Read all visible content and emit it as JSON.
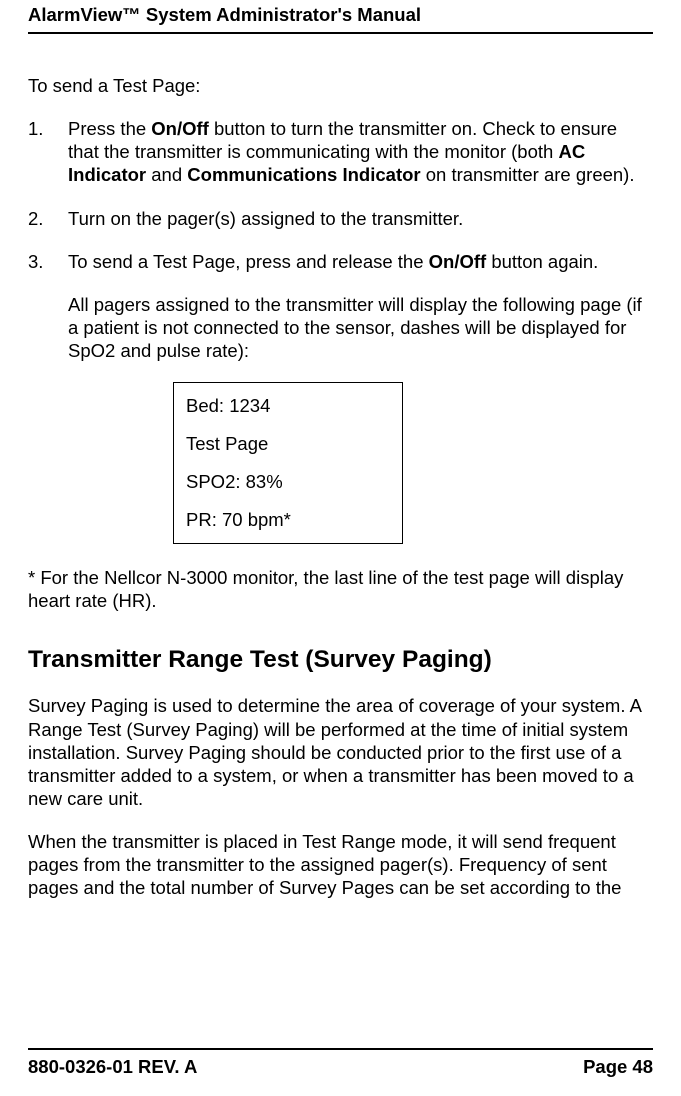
{
  "header": {
    "running_title": "AlarmView™ System Administrator's Manual"
  },
  "intro": {
    "text": "To send a Test Page:"
  },
  "steps": [
    {
      "num": "1.",
      "parts": [
        {
          "t": "Press the ",
          "b": false
        },
        {
          "t": "On/Off",
          "b": true
        },
        {
          "t": " button to turn the transmitter on. Check to ensure that the transmitter is communicating with the monitor (both ",
          "b": false
        },
        {
          "t": "AC Indicator",
          "b": true
        },
        {
          "t": " and ",
          "b": false
        },
        {
          "t": "Communications Indicator",
          "b": true
        },
        {
          "t": " on transmitter are green).",
          "b": false
        }
      ]
    },
    {
      "num": "2.",
      "parts": [
        {
          "t": "Turn on the pager(s) assigned to the transmitter.",
          "b": false
        }
      ]
    },
    {
      "num": "3.",
      "parts": [
        {
          "t": "To send a Test Page, press and release the ",
          "b": false
        },
        {
          "t": "On/Off",
          "b": true
        },
        {
          "t": " button again.",
          "b": false
        }
      ],
      "continuation": "All pagers assigned to the transmitter will display the following page (if a patient is not connected to the sensor, dashes will be displayed for SpO2 and pulse rate):"
    }
  ],
  "display": {
    "lines": [
      "Bed: 1234",
      "Test Page",
      "SPO2: 83%",
      "PR: 70 bpm*"
    ]
  },
  "footnote": {
    "text": "* For the Nellcor N-3000 monitor, the last line of the test page will display heart rate (HR)."
  },
  "section": {
    "heading": "Transmitter Range Test (Survey Paging)",
    "para1": "Survey Paging is used to determine the area of coverage of your system. A Range Test (Survey Paging) will be performed at the time of initial system installation. Survey Paging should be conducted prior to the first use of a transmitter added to a system, or when a transmitter has been moved to a new care unit.",
    "para2": "When the transmitter is placed in Test Range mode, it will send frequent pages from the transmitter to the assigned pager(s).  Frequency of sent pages and the total number of Survey Pages can be set according to the"
  },
  "footer": {
    "doc_rev": "880-0326-01 REV. A",
    "page_label": "Page 48"
  }
}
